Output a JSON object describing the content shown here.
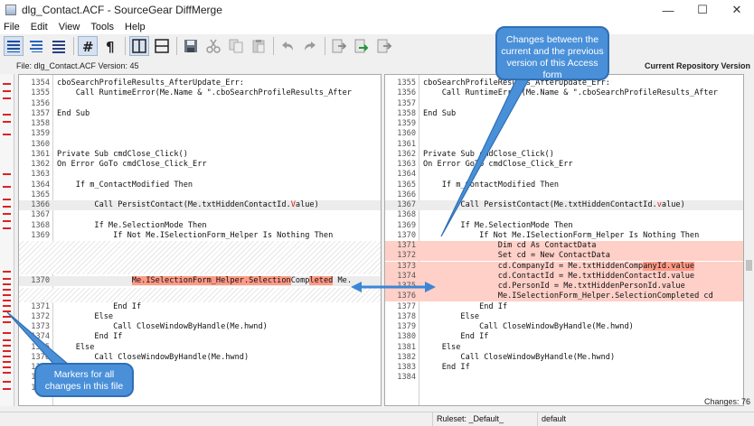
{
  "window": {
    "title": "dlg_Contact.ACF - SourceGear DiffMerge"
  },
  "window_controls": {
    "minimize": "—",
    "maximize": "☐",
    "close": "✕"
  },
  "menu": [
    "File",
    "Edit",
    "View",
    "Tools",
    "Help"
  ],
  "toolbar": {
    "icons": [
      "view-lines-icon",
      "view-lines-alt-icon",
      "view-lines-3-icon",
      "show-line-numbers-icon",
      "show-pilcrow-icon",
      "split-vertical-icon",
      "split-horizontal-icon",
      "save-icon",
      "cut-icon",
      "copy-icon",
      "paste-icon",
      "undo-icon",
      "redo-icon",
      "apply-left-icon",
      "apply-right-icon",
      "apply-both-icon"
    ]
  },
  "left_header": "File: dlg_Contact.ACF Version: 45",
  "right_header": "Current Repository Version",
  "left_lines": [
    {
      "n": "1354",
      "t": "cboSearchProfileResults_AfterUpdate_Err:"
    },
    {
      "n": "1355",
      "t": "    Call RuntimeError(Me.Name & \".cboSearchProfileResults_After"
    },
    {
      "n": "1356",
      "t": ""
    },
    {
      "n": "1357",
      "t": "End Sub"
    },
    {
      "n": "1358",
      "t": ""
    },
    {
      "n": "1359",
      "t": ""
    },
    {
      "n": "1360",
      "t": ""
    },
    {
      "n": "1361",
      "t": "Private Sub cmdClose_Click()"
    },
    {
      "n": "1362",
      "t": "On Error GoTo cmdClose_Click_Err"
    },
    {
      "n": "1363",
      "t": ""
    },
    {
      "n": "1364",
      "t": "    If m_ContactModified Then"
    },
    {
      "n": "1365",
      "t": ""
    },
    {
      "n": "1366",
      "t": "        Call PersistContact(Me.txtHiddenContactId.",
      "red": "V",
      "rest": "alue)"
    },
    {
      "n": "1367",
      "t": ""
    },
    {
      "n": "1368",
      "t": "        If Me.SelectionMode Then"
    },
    {
      "n": "1369",
      "t": "            If Not Me.ISelectionForm_Helper Is Nothing Then"
    },
    {
      "n": "1370",
      "t": "                ",
      "redbg": "Me.ISelectionForm_Helper.Selection",
      "mid": "Comp",
      "red2": "leted",
      "rest": " Me."
    },
    {
      "n": "1371",
      "t": "            End If"
    },
    {
      "n": "1372",
      "t": "        Else"
    },
    {
      "n": "1373",
      "t": "            Call CloseWindowByHandle(Me.hwnd)"
    },
    {
      "n": "1374",
      "t": "        End If"
    },
    {
      "n": "1375",
      "t": "    Else"
    },
    {
      "n": "1376",
      "t": "        Call CloseWindowByHandle(Me.hwnd)"
    },
    {
      "n": "1377",
      "t": ""
    },
    {
      "n": "1378",
      "t": ""
    },
    {
      "n": "1379",
      "t": ""
    }
  ],
  "right_lines": [
    {
      "n": "1355",
      "t": "cboSearchProfileResults_AfterUpdate_Err:"
    },
    {
      "n": "1356",
      "t": "    Call RuntimeError(Me.Name & \".cboSearchProfileResults_After"
    },
    {
      "n": "1357",
      "t": ""
    },
    {
      "n": "1358",
      "t": "End Sub"
    },
    {
      "n": "1359",
      "t": ""
    },
    {
      "n": "1360",
      "t": ""
    },
    {
      "n": "1361",
      "t": ""
    },
    {
      "n": "1362",
      "t": "Private Sub cmdClose_Click()"
    },
    {
      "n": "1363",
      "t": "On Error GoTo cmdClose_Click_Err"
    },
    {
      "n": "1364",
      "t": ""
    },
    {
      "n": "1365",
      "t": "    If m_ContactModified Then"
    },
    {
      "n": "1366",
      "t": ""
    },
    {
      "n": "1367",
      "t": "        Call PersistContact(Me.txtHiddenContactId.",
      "red": "v",
      "rest": "alue)"
    },
    {
      "n": "1368",
      "t": ""
    },
    {
      "n": "1369",
      "t": "        If Me.SelectionMode Then"
    },
    {
      "n": "1370",
      "t": "            If Not Me.ISelectionForm_Helper Is Nothing Then"
    },
    {
      "n": "1371",
      "t": "                Dim cd As ContactData"
    },
    {
      "n": "1372",
      "t": "                Set cd = New ContactData"
    },
    {
      "n": "1373",
      "t": "                cd.CompanyId = Me.txtHiddenComp",
      "redbg": "anyId.value"
    },
    {
      "n": "1374",
      "t": "                cd.ContactId = Me.txtHiddenContactId.value"
    },
    {
      "n": "1375",
      "t": "                cd.PersonId = Me.txtHiddenPersonId.value"
    },
    {
      "n": "1376",
      "t": "                Me.ISelectionForm_Helper.SelectionCompleted cd"
    },
    {
      "n": "1377",
      "t": "            End If"
    },
    {
      "n": "1378",
      "t": "        Else"
    },
    {
      "n": "1379",
      "t": "            Call CloseWindowByHandle(Me.hwnd)"
    },
    {
      "n": "1380",
      "t": "        End If"
    },
    {
      "n": "1381",
      "t": "    Else"
    },
    {
      "n": "1382",
      "t": "        Call CloseWindowByHandle(Me.hwnd)"
    },
    {
      "n": "1383",
      "t": "    End If"
    },
    {
      "n": "1384",
      "t": ""
    }
  ],
  "changes_label": "Changes: 76",
  "status": {
    "ruleset": "Ruleset: _Default_",
    "mode": "default"
  },
  "callouts": {
    "changes": "Changes between the current and the previous version of this Access form",
    "markers": "Markers for all changes in this file"
  },
  "colors": {
    "accent": "#4a90d9",
    "change_bg": "#ffd0c8",
    "change_strong": "#ff9a86",
    "marker": "#d22222"
  }
}
